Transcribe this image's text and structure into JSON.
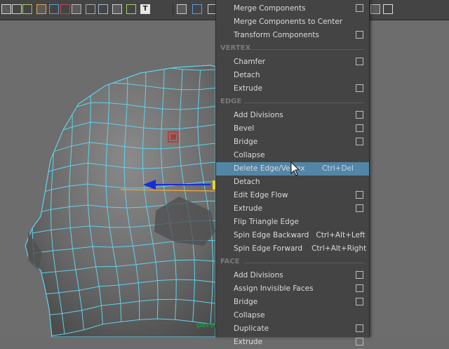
{
  "colors": {
    "toolbar_bg": "#444444",
    "menu_bg": "#444444",
    "highlight": "#5285a6",
    "wireframe": "#5fd3ee",
    "section_text": "#7a7a7a"
  },
  "toolbar": {
    "icons": [
      "select-icon",
      "lasso-icon",
      "paint-select-icon",
      "move-icon",
      "rotate-icon",
      "scale-icon",
      "display-icon",
      "grid-icon",
      "smooth-shade-icon",
      "wireframe-shade-icon",
      "texture-icon",
      "text-icon",
      "cube-icon",
      "cube-blue-icon",
      "cube-right-icon",
      "render-icon",
      "hierarchy-icon"
    ]
  },
  "viewport": {
    "camera_label": "persp"
  },
  "menu": {
    "groups": [
      {
        "items": [
          {
            "label": "Merge Components",
            "checkbox": true
          },
          {
            "label": "Merge Components to Center",
            "checkbox": false
          },
          {
            "label": "Transform Components",
            "checkbox": true
          }
        ]
      },
      {
        "title": "VERTEX",
        "items": [
          {
            "label": "Chamfer",
            "checkbox": true
          },
          {
            "label": "Detach",
            "checkbox": false
          },
          {
            "label": "Extrude",
            "checkbox": true
          }
        ]
      },
      {
        "title": "EDGE",
        "items": [
          {
            "label": "Add Divisions",
            "checkbox": true
          },
          {
            "label": "Bevel",
            "checkbox": true
          },
          {
            "label": "Bridge",
            "checkbox": true
          },
          {
            "label": "Collapse",
            "checkbox": false
          },
          {
            "label": "Delete Edge/Vertex",
            "shortcut": "Ctrl+Del",
            "checkbox": false,
            "highlighted": true
          },
          {
            "label": "Detach",
            "checkbox": false
          },
          {
            "label": "Edit Edge Flow",
            "checkbox": true
          },
          {
            "label": "Extrude",
            "checkbox": true
          },
          {
            "label": "Flip Triangle Edge",
            "checkbox": false
          },
          {
            "label": "Spin Edge Backward",
            "shortcut": "Ctrl+Alt+Left",
            "checkbox": false
          },
          {
            "label": "Spin Edge Forward",
            "shortcut": "Ctrl+Alt+Right",
            "checkbox": false
          }
        ]
      },
      {
        "title": "FACE",
        "items": [
          {
            "label": "Add Divisions",
            "checkbox": true
          },
          {
            "label": "Assign Invisible Faces",
            "checkbox": true
          },
          {
            "label": "Bridge",
            "checkbox": true
          },
          {
            "label": "Collapse",
            "checkbox": false
          },
          {
            "label": "Duplicate",
            "checkbox": true
          },
          {
            "label": "Extrude",
            "checkbox": true
          }
        ]
      }
    ]
  }
}
